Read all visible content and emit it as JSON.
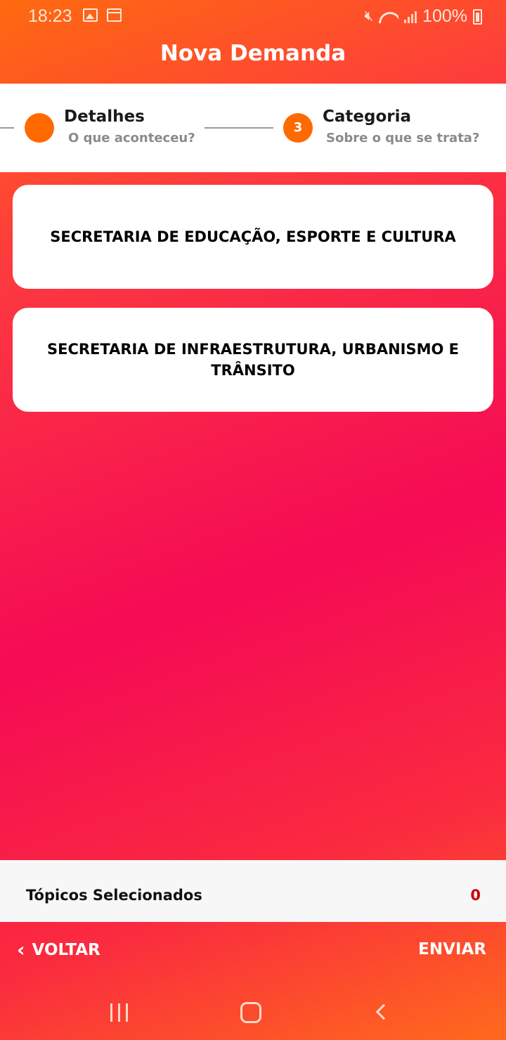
{
  "status_bar": {
    "time": "18:23",
    "battery": "100%",
    "icons": [
      "image-icon",
      "calendar-icon",
      "mute-icon",
      "wifi-icon",
      "signal-icon",
      "battery-charging-icon"
    ]
  },
  "header": {
    "title": "Nova Demanda"
  },
  "stepper": {
    "steps": [
      {
        "title": "Detalhes",
        "subtitle": "O que aconteceu?",
        "number": ""
      },
      {
        "title": "Categoria",
        "subtitle": "Sobre o que se trata?",
        "number": "3"
      }
    ],
    "active_color": "#ff6a00"
  },
  "categories": [
    {
      "label": "SECRETARIA DE EDUCAÇÃO, ESPORTE E CULTURA"
    },
    {
      "label": "SECRETARIA DE INFRAESTRUTURA, URBANISMO E TRÂNSITO"
    }
  ],
  "selected_topics": {
    "label": "Tópicos Selecionados",
    "count": "0",
    "count_color": "#cc0000"
  },
  "actions": {
    "back_label": "VOLTAR",
    "send_label": "ENVIAR"
  },
  "nav_bar": {
    "icons": [
      "recents-icon",
      "home-icon",
      "back-icon"
    ]
  }
}
